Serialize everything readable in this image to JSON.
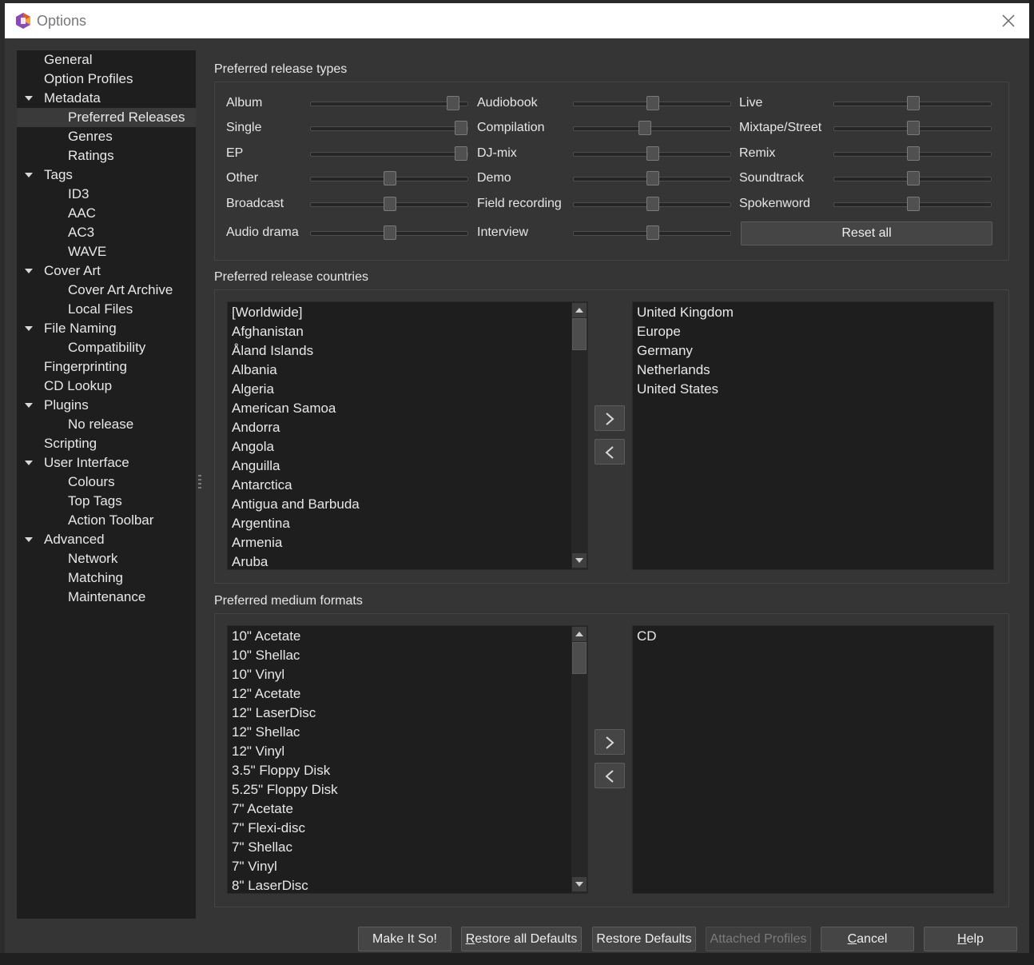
{
  "window": {
    "title": "Options",
    "accent_colors": [
      "#e05a2b",
      "#8a4bb8",
      "#f0a640"
    ]
  },
  "sidebar": {
    "items": [
      {
        "label": "General",
        "level": 0,
        "expandable": false,
        "selected": false
      },
      {
        "label": "Option Profiles",
        "level": 0,
        "expandable": false,
        "selected": false
      },
      {
        "label": "Metadata",
        "level": 0,
        "expandable": true,
        "selected": false
      },
      {
        "label": "Preferred Releases",
        "level": 1,
        "expandable": false,
        "selected": true
      },
      {
        "label": "Genres",
        "level": 1,
        "expandable": false,
        "selected": false
      },
      {
        "label": "Ratings",
        "level": 1,
        "expandable": false,
        "selected": false
      },
      {
        "label": "Tags",
        "level": 0,
        "expandable": true,
        "selected": false
      },
      {
        "label": "ID3",
        "level": 1,
        "expandable": false,
        "selected": false
      },
      {
        "label": "AAC",
        "level": 1,
        "expandable": false,
        "selected": false
      },
      {
        "label": "AC3",
        "level": 1,
        "expandable": false,
        "selected": false
      },
      {
        "label": "WAVE",
        "level": 1,
        "expandable": false,
        "selected": false
      },
      {
        "label": "Cover Art",
        "level": 0,
        "expandable": true,
        "selected": false
      },
      {
        "label": "Cover Art Archive",
        "level": 1,
        "expandable": false,
        "selected": false
      },
      {
        "label": "Local Files",
        "level": 1,
        "expandable": false,
        "selected": false
      },
      {
        "label": "File Naming",
        "level": 0,
        "expandable": true,
        "selected": false
      },
      {
        "label": "Compatibility",
        "level": 1,
        "expandable": false,
        "selected": false
      },
      {
        "label": "Fingerprinting",
        "level": 0,
        "expandable": false,
        "selected": false
      },
      {
        "label": "CD Lookup",
        "level": 0,
        "expandable": false,
        "selected": false
      },
      {
        "label": "Plugins",
        "level": 0,
        "expandable": true,
        "selected": false
      },
      {
        "label": "No release",
        "level": 1,
        "expandable": false,
        "selected": false
      },
      {
        "label": "Scripting",
        "level": 0,
        "expandable": false,
        "selected": false
      },
      {
        "label": "User Interface",
        "level": 0,
        "expandable": true,
        "selected": false
      },
      {
        "label": "Colours",
        "level": 1,
        "expandable": false,
        "selected": false
      },
      {
        "label": "Top Tags",
        "level": 1,
        "expandable": false,
        "selected": false
      },
      {
        "label": "Action Toolbar",
        "level": 1,
        "expandable": false,
        "selected": false
      },
      {
        "label": "Advanced",
        "level": 0,
        "expandable": true,
        "selected": false
      },
      {
        "label": "Network",
        "level": 1,
        "expandable": false,
        "selected": false
      },
      {
        "label": "Matching",
        "level": 1,
        "expandable": false,
        "selected": false
      },
      {
        "label": "Maintenance",
        "level": 1,
        "expandable": false,
        "selected": false
      }
    ]
  },
  "release_types": {
    "title": "Preferred release types",
    "reset_label": "Reset all",
    "columns": [
      [
        {
          "label": "Album",
          "value": 0.9
        },
        {
          "label": "Single",
          "value": 0.95
        },
        {
          "label": "EP",
          "value": 0.95
        },
        {
          "label": "Other",
          "value": 0.5
        },
        {
          "label": "Broadcast",
          "value": 0.5
        },
        {
          "label": "Audio drama",
          "value": 0.5
        }
      ],
      [
        {
          "label": "Audiobook",
          "value": 0.5
        },
        {
          "label": "Compilation",
          "value": 0.45
        },
        {
          "label": "DJ-mix",
          "value": 0.5
        },
        {
          "label": "Demo",
          "value": 0.5
        },
        {
          "label": "Field recording",
          "value": 0.5
        },
        {
          "label": "Interview",
          "value": 0.5
        }
      ],
      [
        {
          "label": "Live",
          "value": 0.5
        },
        {
          "label": "Mixtape/Street",
          "value": 0.5
        },
        {
          "label": "Remix",
          "value": 0.5
        },
        {
          "label": "Soundtrack",
          "value": 0.5
        },
        {
          "label": "Spokenword",
          "value": 0.5
        }
      ]
    ]
  },
  "countries": {
    "title": "Preferred release countries",
    "available": [
      "[Worldwide]",
      "Afghanistan",
      "Åland Islands",
      "Albania",
      "Algeria",
      "American Samoa",
      "Andorra",
      "Angola",
      "Anguilla",
      "Antarctica",
      "Antigua and Barbuda",
      "Argentina",
      "Armenia",
      "Aruba"
    ],
    "selected": [
      "United Kingdom",
      "Europe",
      "Germany",
      "Netherlands",
      "United States"
    ]
  },
  "formats": {
    "title": "Preferred medium formats",
    "available": [
      "10\" Acetate",
      "10\" Shellac",
      "10\" Vinyl",
      "12\" Acetate",
      "12\" LaserDisc",
      "12\" Shellac",
      "12\" Vinyl",
      "3.5\" Floppy Disk",
      "5.25\" Floppy Disk",
      "7\" Acetate",
      "7\" Flexi-disc",
      "7\" Shellac",
      "7\" Vinyl",
      "8\" LaserDisc"
    ],
    "selected": [
      "CD"
    ]
  },
  "footer": {
    "make_it_so": "Make It So!",
    "restore_all_prefix": "R",
    "restore_all_rest": "estore all Defaults",
    "restore_defaults": "Restore Defaults",
    "attached_profiles": "Attached Profiles",
    "cancel_prefix": "C",
    "cancel_rest": "ancel",
    "help_prefix": "H",
    "help_rest": "elp"
  }
}
